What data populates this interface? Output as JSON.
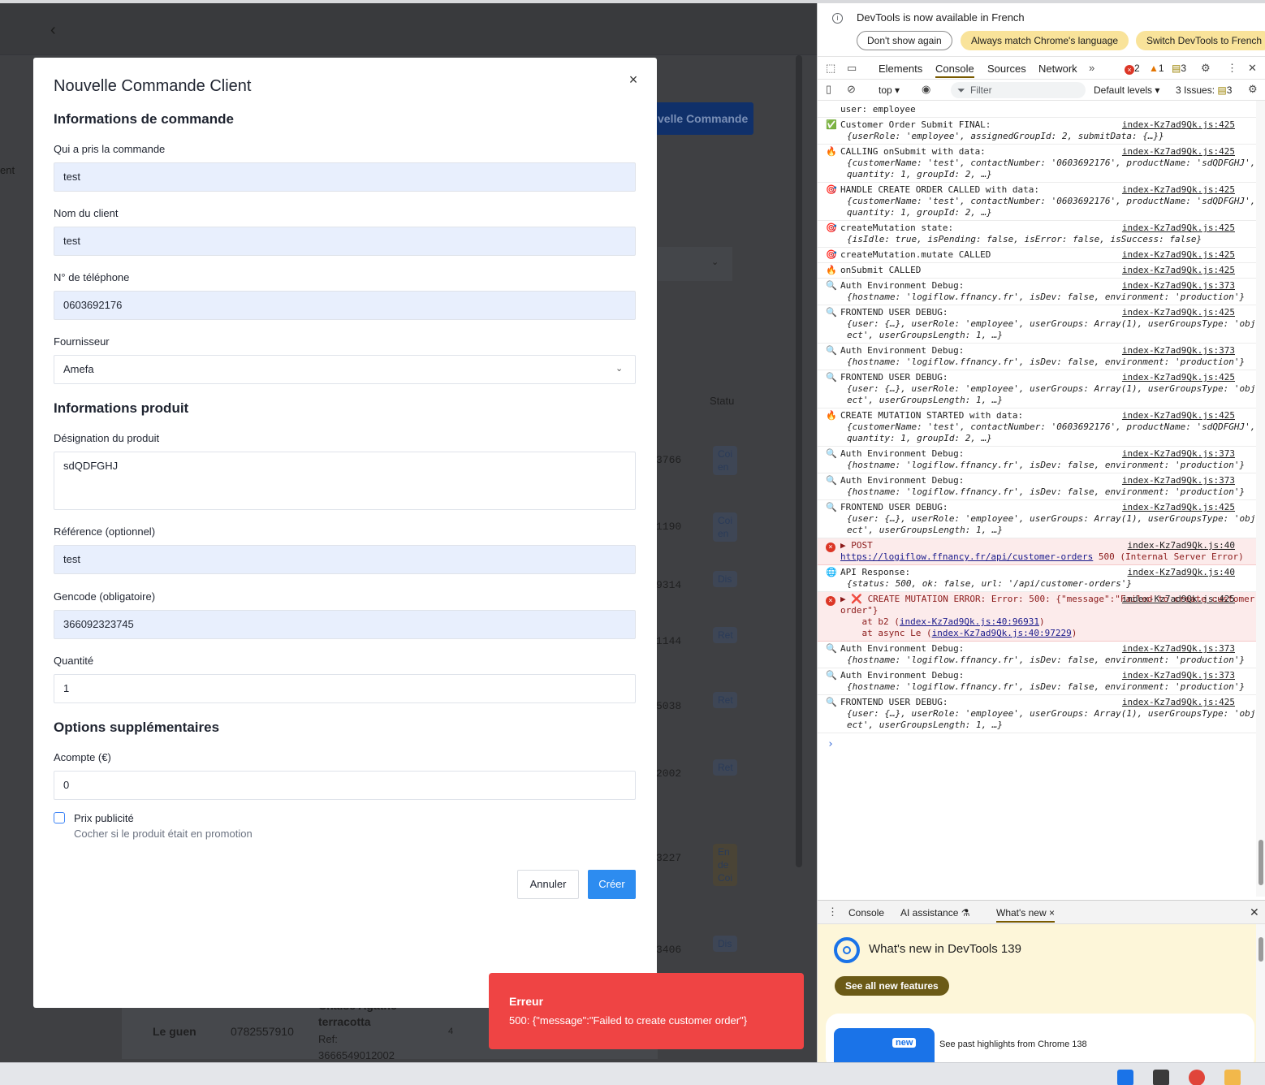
{
  "modal": {
    "title": "Nouvelle Commande Client",
    "section_order": "Informations de commande",
    "taken_by_label": "Qui a pris la commande",
    "taken_by_value": "test",
    "client_name_label": "Nom du client",
    "client_name_value": "test",
    "phone_label": "N° de téléphone",
    "phone_value": "0603692176",
    "supplier_label": "Fournisseur",
    "supplier_value": "Amefa",
    "section_product": "Informations produit",
    "designation_label": "Désignation du produit",
    "designation_value": "sdQDFGHJ",
    "reference_label": "Référence (optionnel)",
    "reference_value": "test",
    "gencode_label": "Gencode (obligatoire)",
    "gencode_value": "366092323745",
    "quantity_label": "Quantité",
    "quantity_value": "1",
    "section_options": "Options supplémentaires",
    "deposit_label": "Acompte (€)",
    "deposit_value": "0",
    "promo_label": "Prix publicité",
    "promo_hint": "Cocher si le produit était en promotion",
    "promo_checked": false,
    "cancel_label": "Annuler",
    "create_label": "Créer"
  },
  "toast": {
    "title": "Erreur",
    "message": "500: {\"message\":\"Failed to create customer order\"}"
  },
  "background": {
    "new_order_button": "velle Commande",
    "left_text": "ent",
    "status_header": "Statu",
    "row_numbers": [
      "3766",
      "1190",
      "9314",
      "1144",
      "5038",
      "2002",
      "3227",
      "3406"
    ],
    "row_badges": [
      "Coi en",
      "Coi en",
      "Dis",
      "Ret",
      "Ret",
      "Ret",
      "En de Coi",
      "Dis"
    ],
    "last_row_name": "Le guen",
    "last_row_phone": "0782557910",
    "last_row_product_line1": "Chaise Agathe",
    "last_row_product_line2": "terracotta",
    "last_row_ref_label": "Ref:",
    "last_row_ref": "3666549012002",
    "last_row_qty": "4"
  },
  "devtools": {
    "info_text": "DevTools is now available in French",
    "btn_dont_show": "Don't show again",
    "btn_always_match": "Always match Chrome's language",
    "btn_switch": "Switch DevTools to French",
    "tabs": [
      "Elements",
      "Console",
      "Sources",
      "Network"
    ],
    "error_count": "2",
    "warning_count": "1",
    "message_count": "3",
    "context": "top ▾",
    "filter_placeholder": "Filter",
    "levels": "Default levels ▾",
    "issues": "3 Issues:",
    "issues_count": "3",
    "first_line": "user: employee",
    "logs": [
      {
        "icon": "✅",
        "text": "Customer Order Submit FINAL:",
        "src": "index-Kz7ad9Qk.js:425",
        "obj": "{userRole: 'employee', assignedGroupId: 2, submitData: {…}}"
      },
      {
        "icon": "🔥",
        "text": "CALLING onSubmit with data:",
        "src": "index-Kz7ad9Qk.js:425",
        "obj": "{customerName: 'test', contactNumber: '0603692176', productName: 'sdQDFGHJ', quantity: 1, groupId: 2, …}"
      },
      {
        "icon": "🎯",
        "text": "HANDLE CREATE ORDER CALLED with data:",
        "src": "index-Kz7ad9Qk.js:425",
        "obj": "{customerName: 'test', contactNumber: '0603692176', productName: 'sdQDFGHJ', quantity: 1, groupId: 2, …}"
      },
      {
        "icon": "🎯",
        "text": "createMutation state:",
        "src": "index-Kz7ad9Qk.js:425",
        "obj": "{isIdle: true, isPending: false, isError: false, isSuccess: false}"
      },
      {
        "icon": "🎯",
        "text": "createMutation.mutate CALLED",
        "src": "index-Kz7ad9Qk.js:425",
        "obj": ""
      },
      {
        "icon": "🔥",
        "text": "onSubmit CALLED",
        "src": "index-Kz7ad9Qk.js:425",
        "obj": ""
      },
      {
        "icon": "🔍",
        "text": "Auth Environment Debug:",
        "src": "index-Kz7ad9Qk.js:373",
        "obj": "{hostname: 'logiflow.ffnancy.fr', isDev: false, environment: 'production'}"
      },
      {
        "icon": "🔍",
        "text": "FRONTEND USER DEBUG:",
        "src": "index-Kz7ad9Qk.js:425",
        "obj": "{user: {…}, userRole: 'employee', userGroups: Array(1), userGroupsType: 'object', userGroupsLength: 1, …}"
      },
      {
        "icon": "🔍",
        "text": "Auth Environment Debug:",
        "src": "index-Kz7ad9Qk.js:373",
        "obj": "{hostname: 'logiflow.ffnancy.fr', isDev: false, environment: 'production'}"
      },
      {
        "icon": "🔍",
        "text": "FRONTEND USER DEBUG:",
        "src": "index-Kz7ad9Qk.js:425",
        "obj": "{user: {…}, userRole: 'employee', userGroups: Array(1), userGroupsType: 'object', userGroupsLength: 1, …}"
      },
      {
        "icon": "🔥",
        "text": "CREATE MUTATION STARTED with data:",
        "src": "index-Kz7ad9Qk.js:425",
        "obj": "{customerName: 'test', contactNumber: '0603692176', productName: 'sdQDFGHJ', quantity: 1, groupId: 2, …}"
      },
      {
        "icon": "🔍",
        "text": "Auth Environment Debug:",
        "src": "index-Kz7ad9Qk.js:373",
        "obj": "{hostname: 'logiflow.ffnancy.fr', isDev: false, environment: 'production'}"
      },
      {
        "icon": "🔍",
        "text": "Auth Environment Debug:",
        "src": "index-Kz7ad9Qk.js:373",
        "obj": "{hostname: 'logiflow.ffnancy.fr', isDev: false, environment: 'production'}"
      },
      {
        "icon": "🔍",
        "text": "FRONTEND USER DEBUG:",
        "src": "index-Kz7ad9Qk.js:425",
        "obj": "{user: {…}, userRole: 'employee', userGroups: Array(1), userGroupsType: 'object', userGroupsLength: 1, …}"
      }
    ],
    "post_error": {
      "method": "▶ POST",
      "src": "index-Kz7ad9Qk.js:40",
      "url": "https://logiflow.ffnancy.fr/api/customer-orders",
      "status": " 500 (Internal Server Error)"
    },
    "api_response": {
      "text": "API Response:",
      "src": "index-Kz7ad9Qk.js:40",
      "obj": "{status: 500, ok: false, url: '/api/customer-orders'}"
    },
    "mutation_error": {
      "text": "▶ ❌ CREATE MUTATION ERROR: Error: 500: {\"message\":\"Failed to create customer order\"}",
      "src": "index-Kz7ad9Qk.js:425",
      "stack1_prefix": "    at b2 (",
      "stack1_link": "index-Kz7ad9Qk.js:40:96931",
      "stack2_prefix": "    at async Le (",
      "stack2_link": "index-Kz7ad9Qk.js:40:97229"
    },
    "tail_logs": [
      {
        "icon": "🔍",
        "text": "Auth Environment Debug:",
        "src": "index-Kz7ad9Qk.js:373",
        "obj": "{hostname: 'logiflow.ffnancy.fr', isDev: false, environment: 'production'}"
      },
      {
        "icon": "🔍",
        "text": "Auth Environment Debug:",
        "src": "index-Kz7ad9Qk.js:373",
        "obj": "{hostname: 'logiflow.ffnancy.fr', isDev: false, environment: 'production'}"
      },
      {
        "icon": "🔍",
        "text": "FRONTEND USER DEBUG:",
        "src": "index-Kz7ad9Qk.js:425",
        "obj": "{user: {…}, userRole: 'employee', userGroups: Array(1), userGroupsType: 'object', userGroupsLength: 1, …}"
      }
    ],
    "drawer_tabs": [
      "Console",
      "AI assistance",
      "What's new"
    ],
    "whatsnew_title": "What's new in DevTools 139",
    "whatsnew_button": "See all new features",
    "whatsnew_card_badge": "new",
    "whatsnew_card_text": "See past highlights from Chrome 138"
  },
  "colors": {
    "primary": "#2d8cf0",
    "toast_error": "#ef4444",
    "field_filled": "#e8effd",
    "devtools_accent": "#f9e39a"
  }
}
